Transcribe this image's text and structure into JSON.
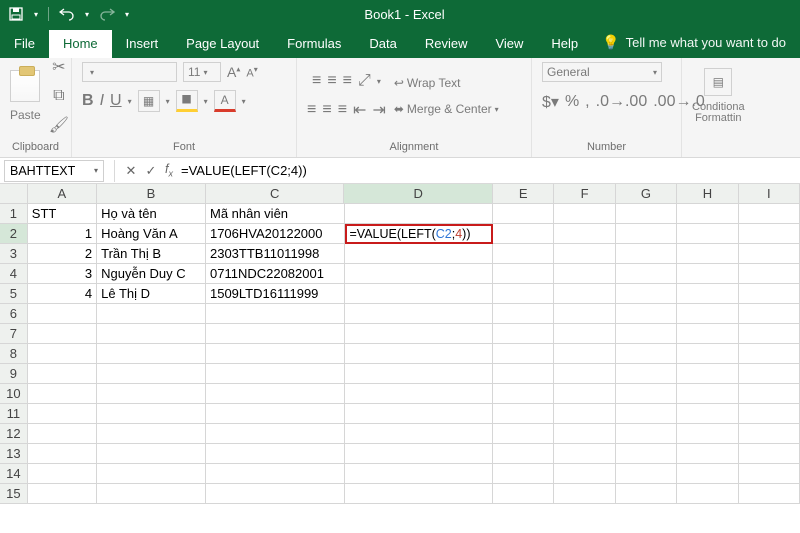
{
  "title": "Book1 - Excel",
  "tabs": {
    "file": "File",
    "home": "Home",
    "insert": "Insert",
    "pagelayout": "Page Layout",
    "formulas": "Formulas",
    "data": "Data",
    "review": "Review",
    "view": "View",
    "help": "Help",
    "tellme": "Tell me what you want to do"
  },
  "ribbon": {
    "clipboard": {
      "paste": "Paste",
      "label": "Clipboard"
    },
    "font": {
      "family": "",
      "size": "11",
      "bold": "B",
      "italic": "I",
      "underline": "U",
      "incA": "A",
      "decA": "A",
      "label": "Font"
    },
    "alignment": {
      "wrap": "Wrap Text",
      "merge": "Merge & Center",
      "label": "Alignment"
    },
    "number": {
      "format": "General",
      "label": "Number"
    },
    "styles": {
      "cond": "Conditiona",
      "cond2": "Formattin"
    }
  },
  "namebox": "BAHTTEXT",
  "formula_text": "=VALUE(LEFT(C2;4))",
  "columns": [
    "A",
    "B",
    "C",
    "D",
    "E",
    "F",
    "G",
    "H",
    "I"
  ],
  "active_col_index": 3,
  "active_row": 2,
  "rows": 15,
  "headers": {
    "A": "STT",
    "B": "Họ và tên",
    "C": "Mã nhân viên"
  },
  "data": [
    {
      "A": "1",
      "B": "Hoàng Văn A",
      "C": "1706HVA20122000"
    },
    {
      "A": "2",
      "B": "Trần Thị B",
      "C": "2303TTB11011998"
    },
    {
      "A": "3",
      "B": "Nguyễn Duy C",
      "C": "0711NDC22082001"
    },
    {
      "A": "4",
      "B": "Lê Thị D",
      "C": "1509LTD16111999"
    }
  ],
  "editing_cell": {
    "prefix": "=VALUE(LEFT(",
    "ref": "C2",
    "sep": ";",
    "num": "4",
    "suffix": "))"
  }
}
